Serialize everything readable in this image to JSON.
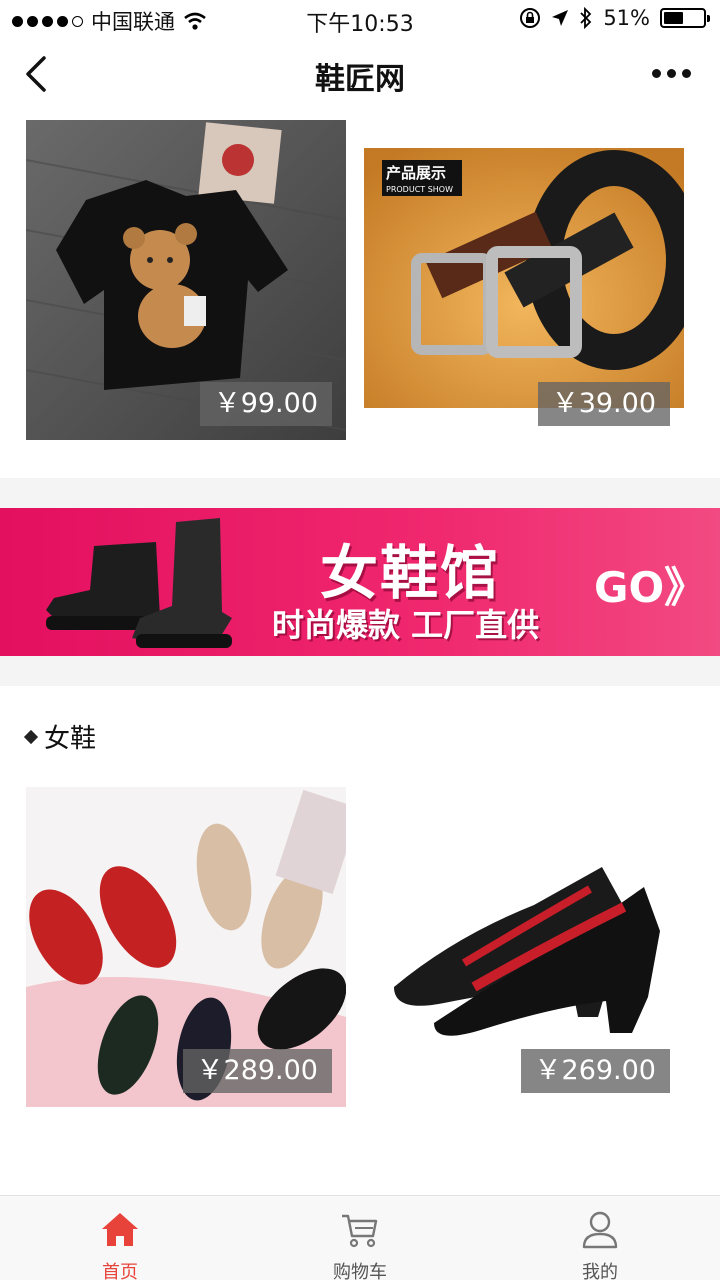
{
  "status_bar": {
    "carrier": "中国联通",
    "time": "下午10:53",
    "battery_text": "51%",
    "battery_level": 0.51
  },
  "nav": {
    "title": "鞋匠网"
  },
  "products_top": [
    {
      "price": "￥99.00"
    },
    {
      "price": "￥39.00",
      "badge_title": "产品展示",
      "badge_sub": "PRODUCT SHOW"
    }
  ],
  "banner": {
    "title": "女鞋馆",
    "subtitle": "时尚爆款 工厂直供",
    "cta": "GO》"
  },
  "section": {
    "title": "女鞋"
  },
  "products_women": [
    {
      "price": "￥289.00"
    },
    {
      "price": "￥269.00"
    }
  ],
  "tabbar": {
    "items": [
      {
        "label": "首页",
        "icon": "home-icon"
      },
      {
        "label": "购物车",
        "icon": "cart-icon"
      },
      {
        "label": "我的",
        "icon": "user-icon"
      }
    ],
    "active_color": "#e8433b"
  },
  "colors": {
    "banner_pink": "#e30f5f",
    "accent_red": "#e8433b"
  }
}
